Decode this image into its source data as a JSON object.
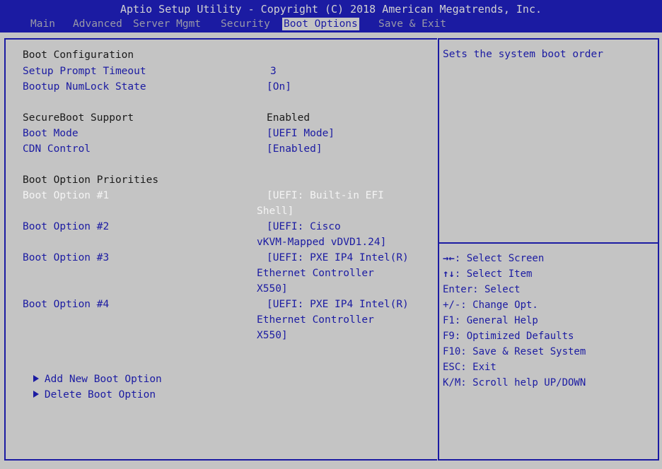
{
  "title": "Aptio Setup Utility - Copyright (C) 2018 American Megatrends, Inc.",
  "menu": [
    {
      "label": "Main",
      "active": false
    },
    {
      "label": "Advanced",
      "active": false
    },
    {
      "label": "Server Mgmt",
      "active": false
    },
    {
      "label": "Security",
      "active": false
    },
    {
      "label": "Boot Options",
      "active": true
    },
    {
      "label": "Save & Exit",
      "active": false
    }
  ],
  "main": {
    "boot_config_heading": "Boot Configuration",
    "setup_prompt_timeout": {
      "label": "Setup Prompt Timeout",
      "value": "3"
    },
    "bootup_numlock": {
      "label": "Bootup NumLock State",
      "value": "[On]"
    },
    "secureboot_support": {
      "label": "SecureBoot Support",
      "value": "Enabled"
    },
    "boot_mode": {
      "label": "Boot Mode",
      "value": "[UEFI Mode]"
    },
    "cdn_control": {
      "label": "CDN Control",
      "value": "[Enabled]"
    },
    "priorities_heading": "Boot Option Priorities",
    "boot_options": [
      {
        "label": "Boot Option #1",
        "value_lines": [
          "[UEFI: Built-in EFI",
          "Shell]"
        ],
        "selected": true
      },
      {
        "label": "Boot Option #2",
        "value_lines": [
          "[UEFI: Cisco",
          "vKVM-Mapped vDVD1.24]"
        ],
        "selected": false
      },
      {
        "label": "Boot Option #3",
        "value_lines": [
          "[UEFI: PXE IP4 Intel(R)",
          "Ethernet Controller",
          "X550]"
        ],
        "selected": false
      },
      {
        "label": "Boot Option #4",
        "value_lines": [
          "[UEFI: PXE IP4 Intel(R)",
          "Ethernet Controller",
          "X550]"
        ],
        "selected": false
      }
    ],
    "submenus": [
      {
        "label": "Add New Boot Option"
      },
      {
        "label": "Delete Boot Option"
      }
    ]
  },
  "help": {
    "description": "Sets the system boot order",
    "keys": [
      {
        "key": "→←",
        "text": ": Select Screen",
        "icon": "left-right-arrows-icon"
      },
      {
        "key": "↑↓",
        "text": ": Select Item",
        "icon": "up-down-arrows-icon"
      },
      {
        "key": "",
        "text": "Enter: Select"
      },
      {
        "key": "",
        "text": "+/-: Change Opt."
      },
      {
        "key": "",
        "text": "F1: General Help"
      },
      {
        "key": "",
        "text": "F9: Optimized Defaults"
      },
      {
        "key": "",
        "text": "F10: Save & Reset System"
      },
      {
        "key": "",
        "text": "ESC: Exit"
      },
      {
        "key": "",
        "text": "K/M: Scroll help UP/DOWN"
      }
    ]
  },
  "colors": {
    "bios_blue": "#1b1ba2",
    "background_gray": "#c4c4c4",
    "selected_white": "#f4f4f4"
  }
}
